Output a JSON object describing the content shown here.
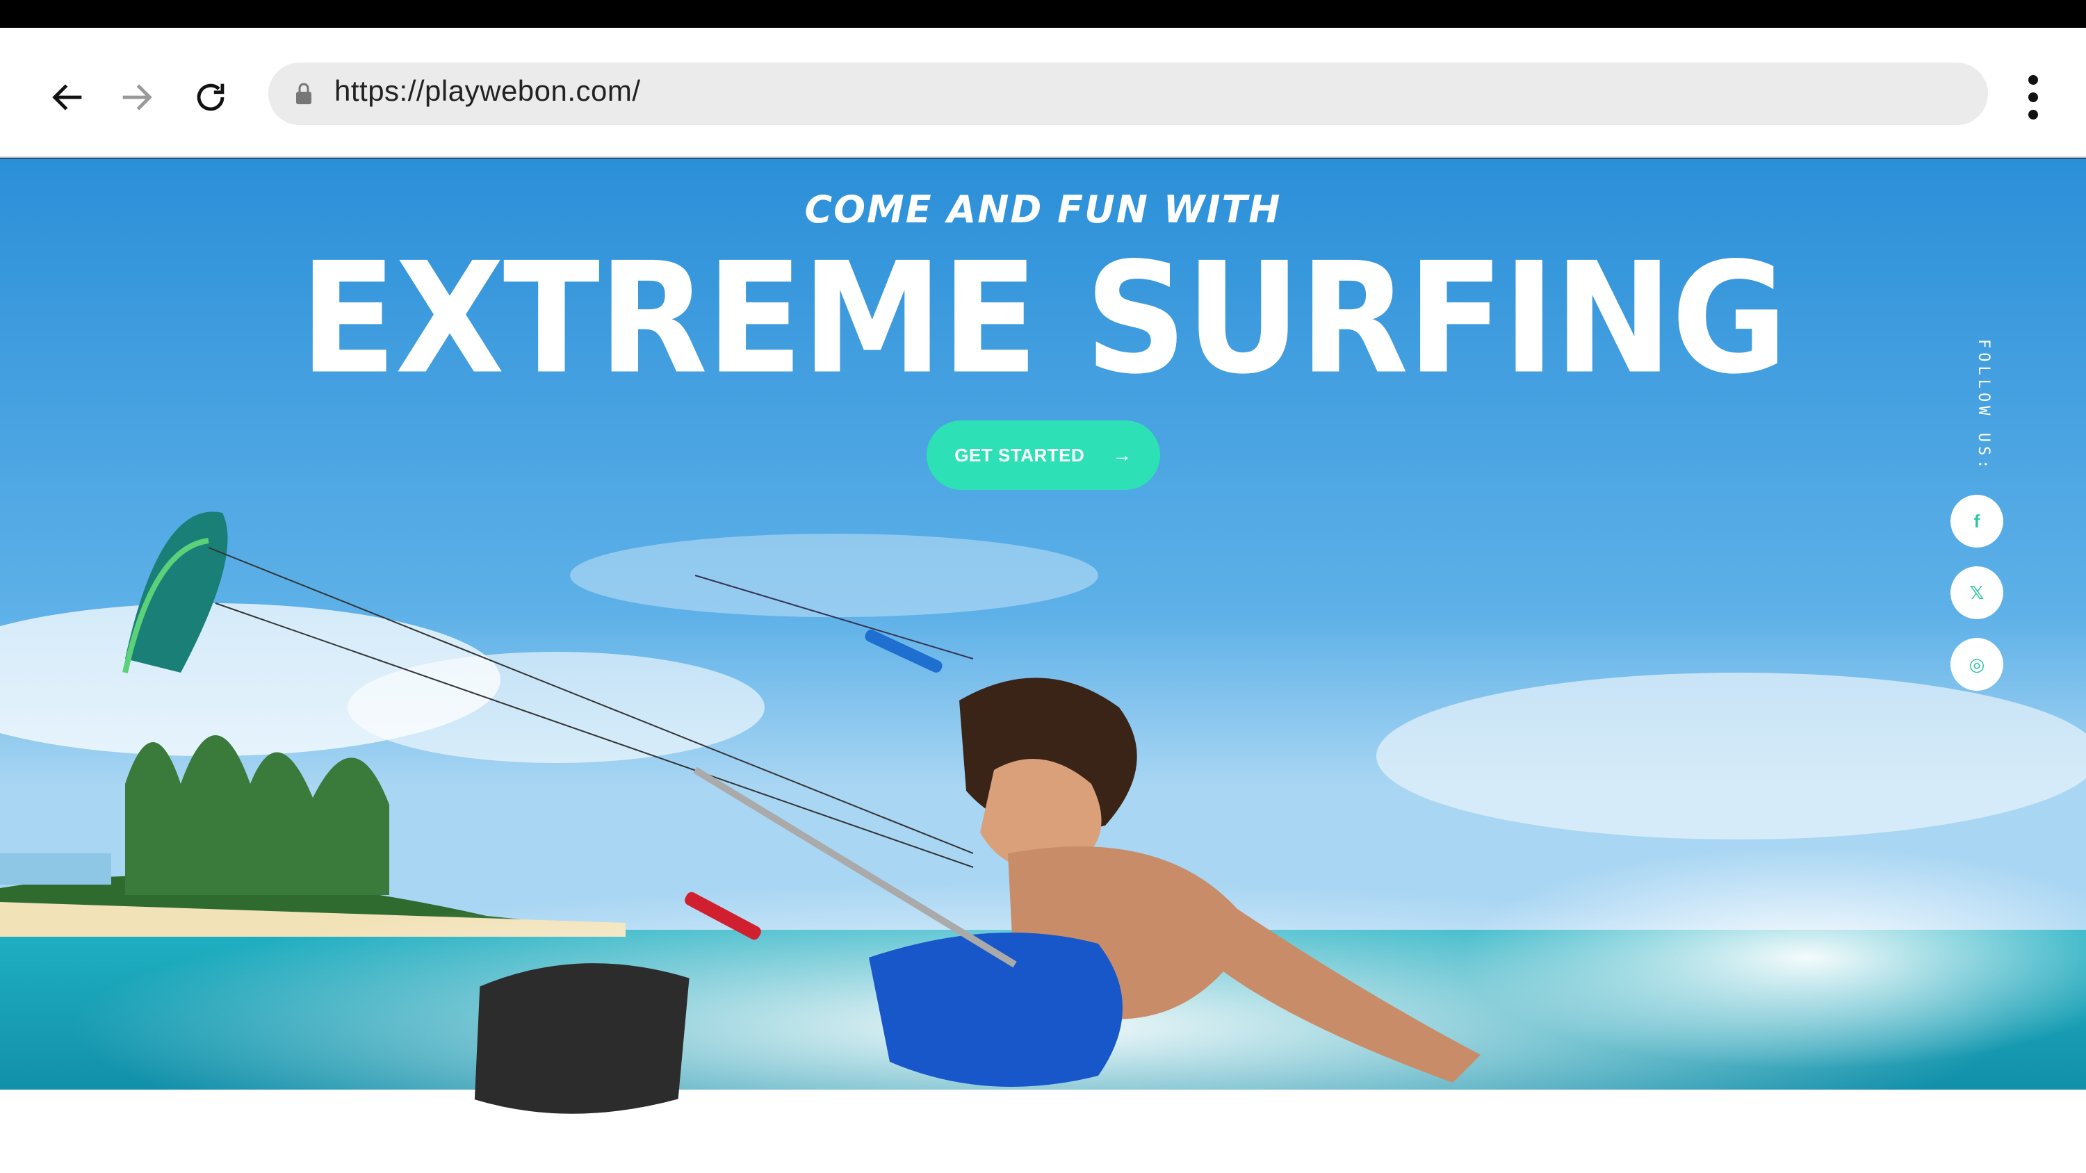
{
  "browser": {
    "url": "https://playwebon.com/",
    "back_icon": "arrow-left-icon",
    "forward_icon": "arrow-right-icon",
    "reload_icon": "reload-icon",
    "lock_icon": "lock-icon",
    "menu_icon": "more-vertical-icon"
  },
  "hero": {
    "kicker": "COME AND FUN WITH",
    "headline": "EXTREME SURFING",
    "cta_label": "GET STARTED",
    "cta_icon": "arrow-right-icon",
    "accent_color": "#2ee0b5",
    "sky_color": "#2b8fd8"
  },
  "social": {
    "label": "FOLLOW US:",
    "links": [
      {
        "name": "facebook-icon",
        "glyph": "f"
      },
      {
        "name": "x-twitter-icon",
        "glyph": "𝕏"
      },
      {
        "name": "instagram-icon",
        "glyph": "◎"
      }
    ]
  }
}
